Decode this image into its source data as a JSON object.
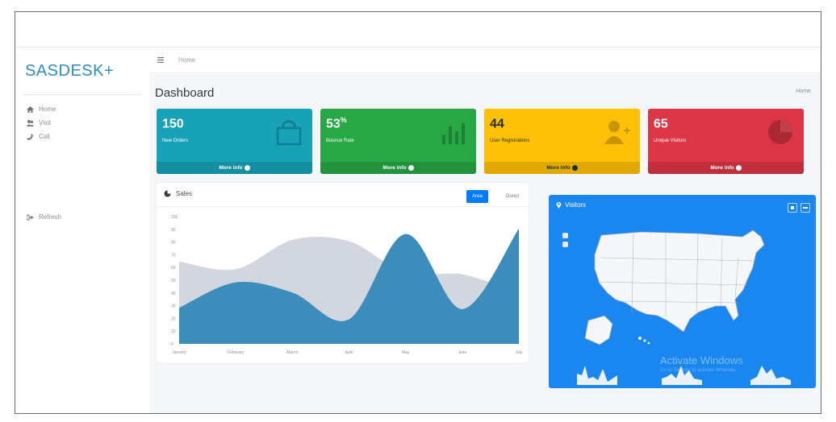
{
  "brand": "SASDESK+",
  "sidebar": {
    "items": [
      {
        "label": "Home",
        "icon": "home-icon"
      },
      {
        "label": "Visit",
        "icon": "users-icon"
      },
      {
        "label": "Call",
        "icon": "phone-icon"
      },
      {
        "label": "Refresh",
        "icon": "signout-icon"
      }
    ]
  },
  "topbar": {
    "breadcrumb": "Home"
  },
  "header": {
    "title": "Dashboard",
    "breadcrumb_right": "Home"
  },
  "boxes": [
    {
      "value": "150",
      "suffix": "",
      "label": "New Orders",
      "footer": "More info",
      "color": "#17a2b8",
      "icon": "bag-icon"
    },
    {
      "value": "53",
      "suffix": "%",
      "label": "Bounce Rate",
      "footer": "More info",
      "color": "#28a745",
      "icon": "bar-chart-icon"
    },
    {
      "value": "44",
      "suffix": "",
      "label": "User Registrations",
      "footer": "More info",
      "color": "#ffc107",
      "icon": "user-plus-icon"
    },
    {
      "value": "65",
      "suffix": "",
      "label": "Unique Visitors",
      "footer": "More info",
      "color": "#dc3545",
      "icon": "pie-chart-icon"
    }
  ],
  "sales": {
    "title": "Sales",
    "tabs": [
      "Area",
      "Donut"
    ],
    "active_tab": "Area"
  },
  "visitors": {
    "title": "Visitors",
    "accent": "#1a86f0"
  },
  "watermark": {
    "title": "Activate Windows",
    "subtitle": "Go to Settings to activate Windows."
  },
  "chart_data": {
    "type": "area",
    "categories": [
      "January",
      "February",
      "March",
      "April",
      "May",
      "June",
      "July"
    ],
    "ylim": [
      0,
      100
    ],
    "yticks": [
      0,
      10,
      20,
      30,
      40,
      50,
      60,
      70,
      80,
      90,
      100
    ],
    "series": [
      {
        "values": [
          65,
          59,
          82,
          81,
          56,
          55,
          40
        ],
        "color": "#d2d6de"
      },
      {
        "values": [
          28,
          48,
          40,
          19,
          86,
          27,
          90
        ],
        "color": "#3c8dbc"
      }
    ],
    "legend": "none",
    "grid": false
  }
}
